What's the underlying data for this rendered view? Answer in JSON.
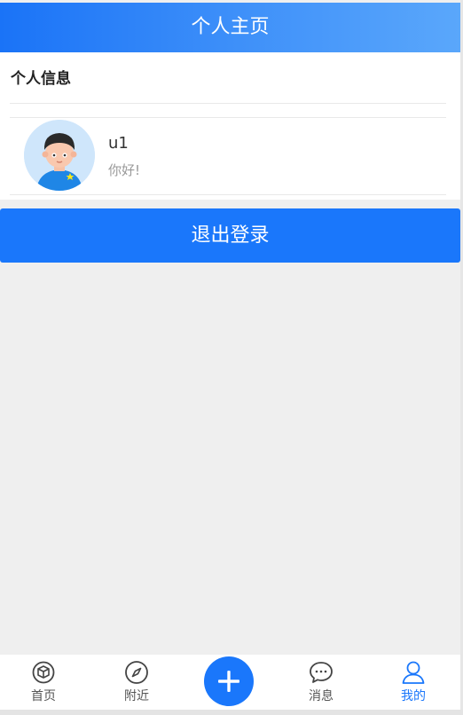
{
  "header": {
    "title": "个人主页"
  },
  "profile": {
    "section_title": "个人信息",
    "avatar_icon": "cartoon-boy-avatar",
    "username": "u1",
    "bio": "你好!"
  },
  "logout_label": "退出登录",
  "tabbar": {
    "active": "mine",
    "tabs": [
      {
        "id": "home",
        "label": "首页",
        "icon": "cube-icon"
      },
      {
        "id": "nearby",
        "label": "附近",
        "icon": "compass-icon"
      },
      {
        "id": "messages",
        "label": "消息",
        "icon": "chat-bubble-icon"
      },
      {
        "id": "mine",
        "label": "我的",
        "icon": "person-icon"
      }
    ],
    "center_button_icon": "plus-icon"
  },
  "colors": {
    "primary": "#1a77fb",
    "header_gradient_start": "#1a73f7",
    "header_gradient_end": "#5aa7fb",
    "background": "#efefef"
  }
}
